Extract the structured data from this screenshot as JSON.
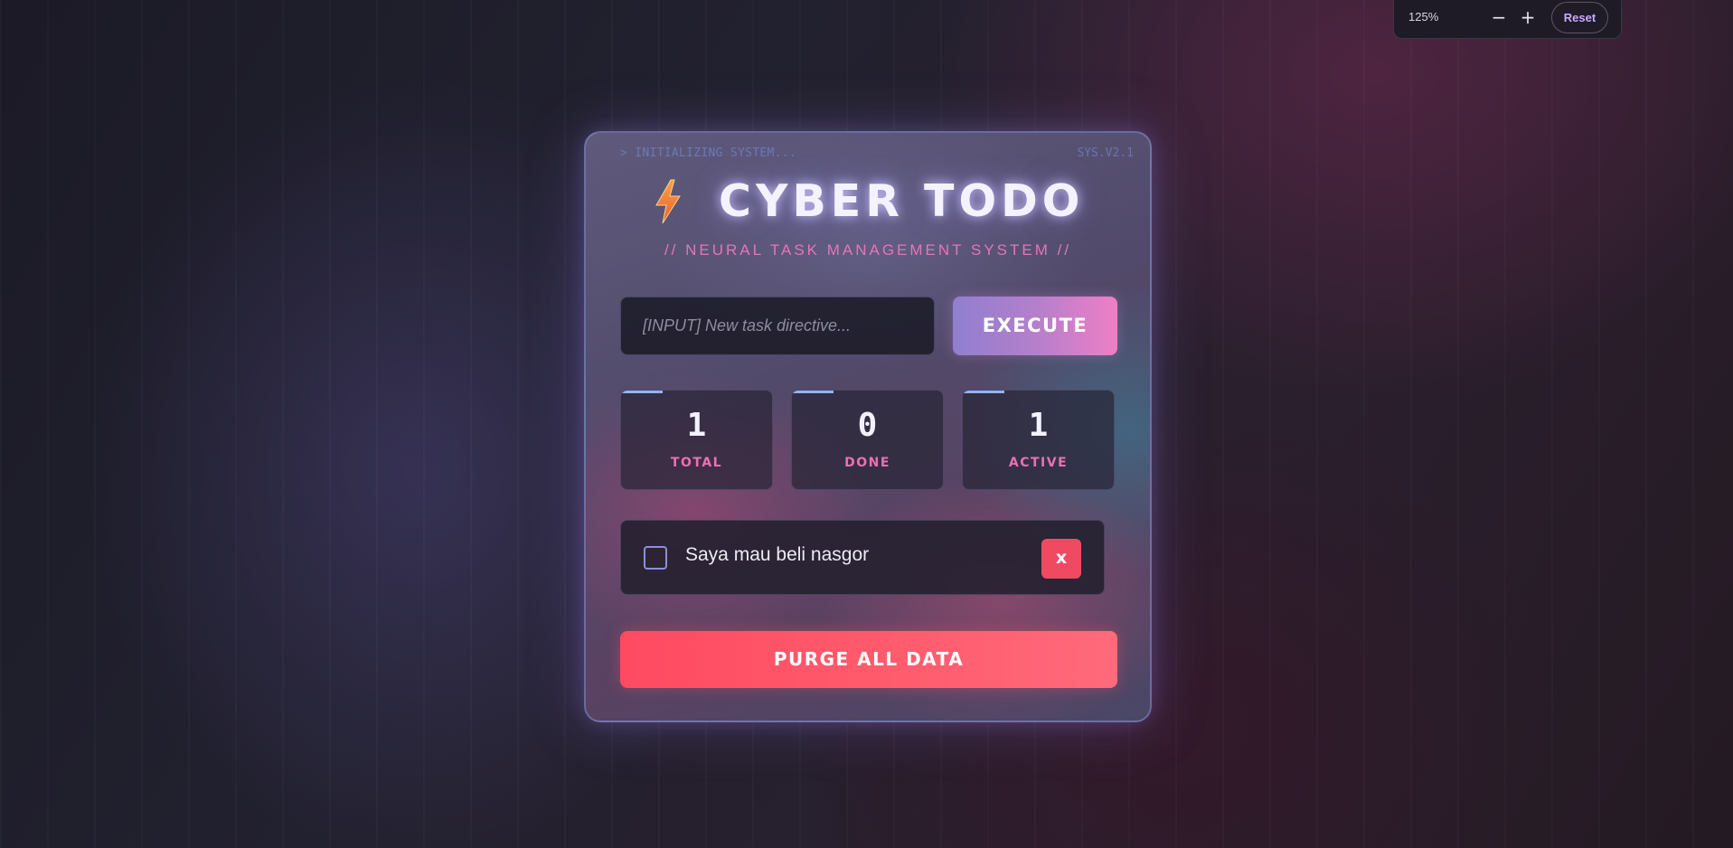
{
  "zoom": {
    "level": "125%",
    "minus_label": "−",
    "plus_label": "+",
    "reset_label": "Reset"
  },
  "app": {
    "status_text": "> INITIALIZING SYSTEM...",
    "version": "SYS.V2.1",
    "title": "CYBER TODO",
    "title_icon": "lightning-bolt-icon",
    "subtitle": "// NEURAL TASK MANAGEMENT SYSTEM //"
  },
  "input": {
    "placeholder": "[INPUT] New task directive...",
    "value": "",
    "execute_label": "EXECUTE"
  },
  "stats": {
    "total": {
      "value": "1",
      "label": "TOTAL"
    },
    "done": {
      "value": "0",
      "label": "DONE"
    },
    "active": {
      "value": "1",
      "label": "ACTIVE"
    }
  },
  "todos": [
    {
      "text": "Saya mau beli nasgor",
      "done": false,
      "delete_label": "x"
    }
  ],
  "actions": {
    "purge_label": "PURGE ALL DATA"
  },
  "colors": {
    "accent_pink": "#ec6fb4",
    "danger": "#ff4a62",
    "stat_bar": "#8fb4ff",
    "bolt": "#f08a3c"
  }
}
